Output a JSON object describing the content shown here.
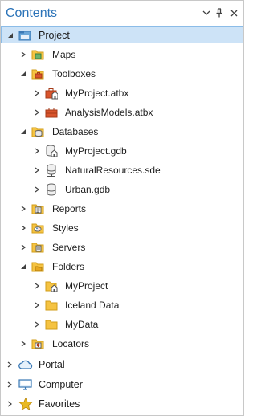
{
  "pane": {
    "title": "Contents"
  },
  "header_buttons": [
    "chevron-down-icon",
    "pin-icon",
    "close-icon"
  ],
  "project": {
    "label": "Project",
    "children": {
      "maps": "Maps",
      "toolboxes": "Toolboxes",
      "toolbox_items": [
        "MyProject.atbx",
        "AnalysisModels.atbx"
      ],
      "databases": "Databases",
      "database_items": [
        "MyProject.gdb",
        "NaturalResources.sde",
        "Urban.gdb"
      ],
      "reports": "Reports",
      "styles": "Styles",
      "servers": "Servers",
      "folders": "Folders",
      "folder_items": [
        "MyProject",
        "Iceland Data",
        "MyData"
      ],
      "locators": "Locators"
    }
  },
  "roots": {
    "portal": "Portal",
    "computer": "Computer",
    "favorites": "Favorites"
  },
  "colors": {
    "accent": "#2b73b8",
    "selection": "#cde3f7",
    "folder": "#f5c342",
    "toolbox": "#d9542c"
  }
}
